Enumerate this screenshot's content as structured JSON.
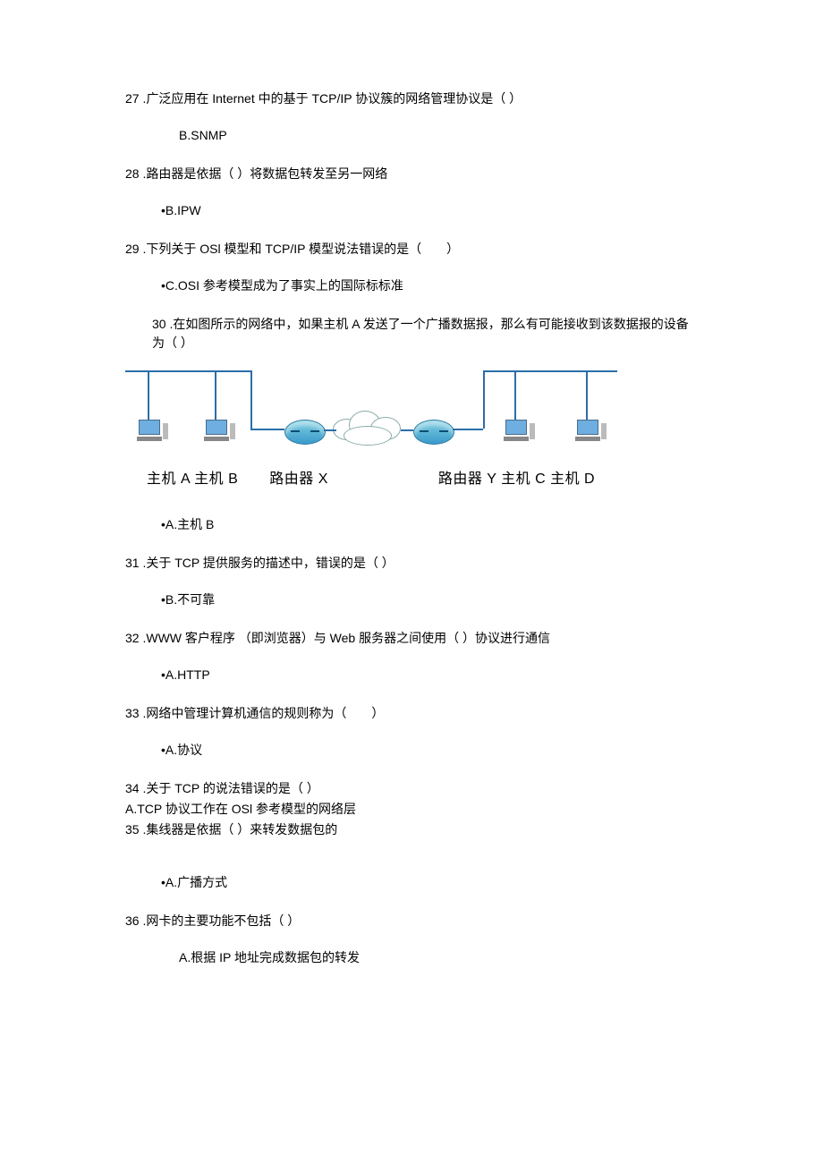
{
  "q27": {
    "num": "27",
    "text": ".广泛应用在 Internet 中的基于 TCP/IP 协议簇的网络管理协议是（ ）",
    "answer": "B.SNMP"
  },
  "q28": {
    "num": "28",
    "text": ".路由器是依据（ ）将数据包转发至另一网络",
    "answer": "•B.IPW"
  },
  "q29": {
    "num": "29",
    "text": ".下列关于 OSl 模型和 TCP/IP 模型说法错误的是（　　）",
    "answer": "•C.OSI 参考模型成为了事实上的国际标标准"
  },
  "q30": {
    "num": "30",
    "text": ".在如图所示的网络中，如果主机 A 发送了一个广播数据报，那么有可能接收到该数据报的设备为（ ）",
    "labels": {
      "hostAB": "主机 A 主机 B",
      "routerX": "路由器 X",
      "right": "路由器 Y 主机 C 主机 D"
    },
    "answer": "•A.主机 B"
  },
  "q31": {
    "num": "31",
    "text": ".关于 TCP 提供服务的描述中，错误的是（ ）",
    "answer": "•B.不可靠"
  },
  "q32": {
    "num": "32",
    "text": ".WWW 客户程序 （即浏览器）与 Web 服务器之间使用（ ）协议进行通信",
    "answer": "•A.HTTP"
  },
  "q33": {
    "num": "33",
    "text": ".网络中管理计算机通信的规则称为（　　）",
    "answer": "•A.协议"
  },
  "q34": {
    "num": "34",
    "text": ".关于 TCP 的说法错误的是（ ）",
    "answer": "A.TCP 协议工作在 OSl 参考模型的网络层"
  },
  "q35": {
    "num": "35",
    "text": ".集线器是依据（ ）来转发数据包的",
    "answer": "•A.广播方式"
  },
  "q36": {
    "num": "36",
    "text": ".网卡的主要功能不包括（ ）",
    "answer": "A.根据 IP 地址完成数据包的转发"
  }
}
